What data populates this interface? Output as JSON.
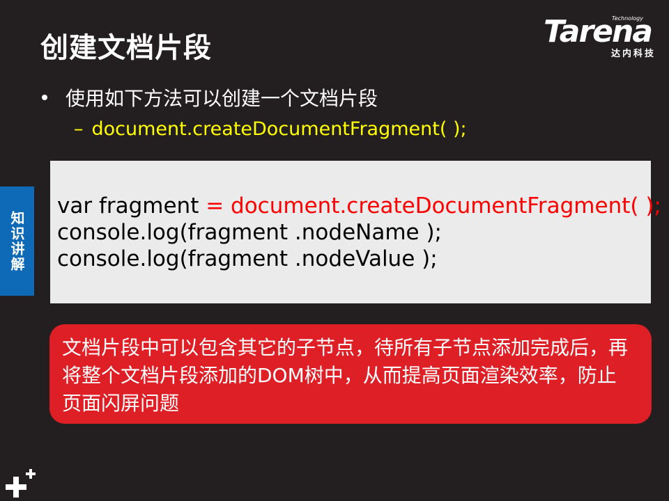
{
  "slide": {
    "title": "创建文档片段"
  },
  "logo": {
    "small_text": "Technology",
    "wordmark": "Tarena",
    "subtitle": "达内科技"
  },
  "content": {
    "bullet": "使用如下方法可以创建一个文档片段",
    "sub_dash": "–",
    "sub_item": "document.createDocumentFragment( );"
  },
  "side_tab": {
    "label": "知识讲解"
  },
  "code": {
    "line1_prefix": "var fragment ",
    "line1_code": "= document.createDocumentFragment( );",
    "line2": "console.log(fragment .nodeName );",
    "line3": "console.log(fragment .nodeValue );"
  },
  "note": {
    "text": "文档片段中可以包含其它的子节点，待所有子节点添加完成后，再将整个文档片段添加的DOM树中，从而提高页面渲染效率，防止页面闪屏问题"
  },
  "colors": {
    "background": "#231f20",
    "accent_yellow": "#ffff00",
    "side_tab_blue": "#0e6ab7",
    "note_red": "#de1f26",
    "code_red": "#ff0000",
    "code_bg": "#ebebeb"
  },
  "icons": {
    "corner": "plus-cluster-icon"
  }
}
